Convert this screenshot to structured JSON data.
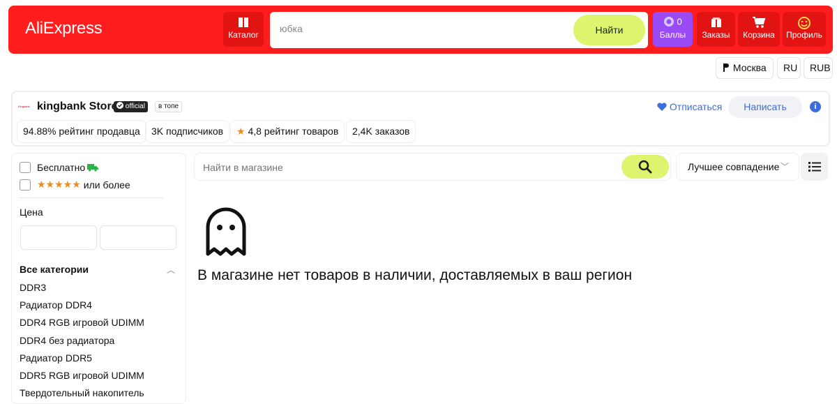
{
  "header": {
    "logo": "AliExpress",
    "catalog_label": "Каталог",
    "search_value": "юбка",
    "search_button": "Найти",
    "points_count": "0",
    "points_label": "Баллы",
    "orders_label": "Заказы",
    "cart_label": "Корзина",
    "profile_label": "Профиль"
  },
  "region": {
    "city": "Москва",
    "lang": "RU",
    "currency": "RUB"
  },
  "store": {
    "logo_text": "Kingbank",
    "name": "kingbank Store",
    "official_badge": "official",
    "top_badge": "в топе",
    "stats": [
      "94.88% рейтинг продавца",
      "3K подписчиков",
      "4,8 рейтинг товаров",
      "2,4K заказов"
    ],
    "unsubscribe": "Отписаться",
    "write": "Написать"
  },
  "filters": {
    "free_label": "Бесплатно",
    "rating_stars": "★★★★★",
    "rating_label": "или более",
    "price_title": "Цена",
    "categories_title": "Все категории",
    "categories": [
      "DDR3",
      "Радиатор DDR4",
      "DDR4 RGB игровой UDIMM",
      "DDR4 без радиатора",
      "Радиатор DDR5",
      "DDR5 RGB игровой UDIMM",
      "Твердотельный накопитель"
    ]
  },
  "main": {
    "shop_search_placeholder": "Найти в магазине",
    "sort_label": "Лучшее совпадение",
    "empty_message": "В магазине нет товаров в наличии, доставляемых в ваш регион"
  },
  "colors": {
    "brand_red": "#ff1d1d",
    "accent_lime": "#ddf56e",
    "points_purple": "#9a4bf5",
    "link_blue": "#3b6ed8"
  }
}
